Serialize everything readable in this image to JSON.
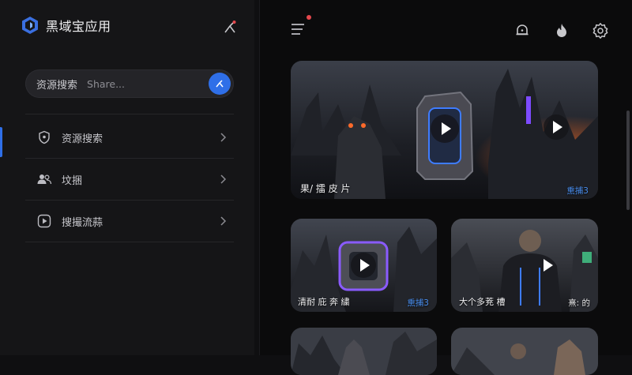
{
  "app": {
    "title": "黑域宝应用",
    "accent": "#2f6fe8"
  },
  "search": {
    "label": "资源搜索",
    "placeholder": "Share..."
  },
  "sidebar": {
    "items": [
      {
        "label": "资源搜索",
        "icon": "shield-icon"
      },
      {
        "label": "坟捆",
        "icon": "users-icon"
      },
      {
        "label": "搜撮流蒜",
        "icon": "play-square-icon"
      }
    ]
  },
  "topbar": {
    "icons": [
      "menu-icon",
      "bell-icon",
      "flame-icon",
      "gear-icon"
    ],
    "notification_color": "#e5484d"
  },
  "cards": [
    {
      "title": "果/ 擂 皮 片",
      "tag": "熏捕3"
    },
    {
      "title": "清耐 庇 奔 繍",
      "tag": "熏捕3"
    },
    {
      "title": "大个多茺 槽",
      "tag": "熹: 的"
    },
    {
      "title": "",
      "tag": ""
    },
    {
      "title": "",
      "tag": ""
    }
  ]
}
